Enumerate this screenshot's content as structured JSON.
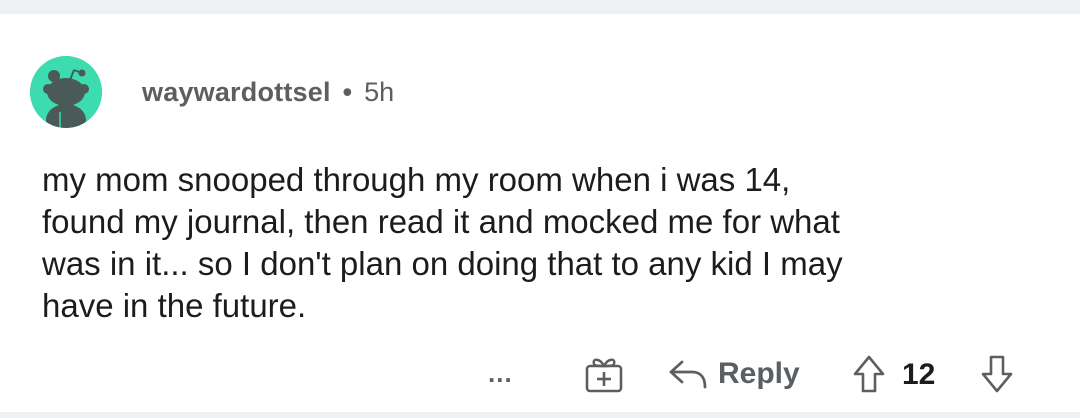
{
  "comment": {
    "username": "waywardottsel",
    "separator": "•",
    "time": "5h",
    "body_lines": [
      "my mom snooped through my room when i was 14,",
      "found my journal, then read it and mocked me for what",
      "was in it... so I don't plan on doing that to any kid I may",
      "have in the future."
    ]
  },
  "actions": {
    "more_label": "...",
    "reply_label": "Reply",
    "score": "12"
  },
  "colors": {
    "avatar_bg": "#3ddbb0",
    "meta_text": "#5c5f62",
    "body_text": "#1c1c1c"
  },
  "icons": [
    "snoo-avatar-icon",
    "ellipsis-icon",
    "award-gift-icon",
    "reply-arrow-icon",
    "upvote-arrow-icon",
    "downvote-arrow-icon"
  ]
}
